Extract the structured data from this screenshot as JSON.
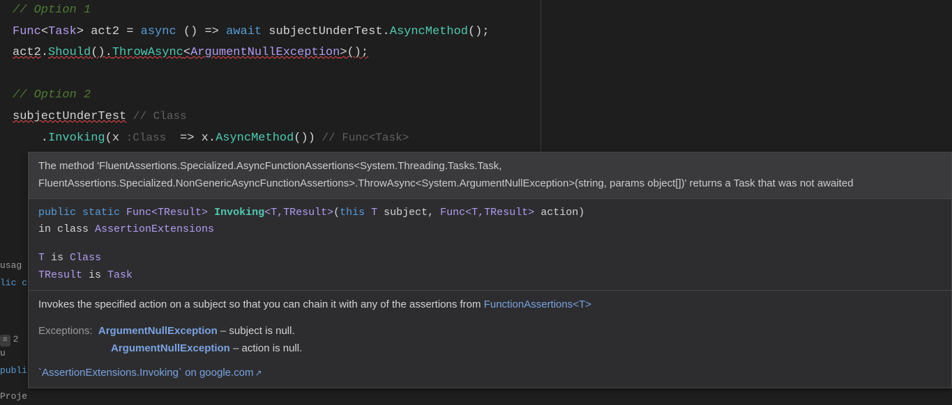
{
  "code": {
    "line0_comment": "// Option 1",
    "line1": {
      "t_func": "Func",
      "t_task": "Task",
      "v_act2": "act2",
      "eq": " = ",
      "k_async": "async",
      "arrow": " () => ",
      "k_await": "await",
      "v_sut": " subjectUnderTest",
      "dot": ".",
      "m_async": "AsyncMethod",
      "tail": "();"
    },
    "line2": {
      "v_act2": "act2",
      "dot1": ".",
      "m_should": "Should",
      "p1": "().",
      "m_throw": "ThrowAsync",
      "lt": "<",
      "t_ex": "ArgumentNullException",
      "gt": ">();"
    },
    "line4_comment": "// Option 2",
    "line5": {
      "v_sut": "subjectUnderTest",
      "hint": " // Class"
    },
    "line6": {
      "pad": "    .",
      "m_inv": "Invoking",
      "open": "(",
      "v_x": "x",
      "hint1": " :Class ",
      "arrow": " => ",
      "v_x2": "x",
      "dot": ".",
      "m_async": "AsyncMethod",
      "close": "())",
      "hint2": " // Func<Task>"
    }
  },
  "tooltip": {
    "warning": "The method 'FluentAssertions.Specialized.AsyncFunctionAssertions<System.Threading.Tasks.Task, FluentAssertions.Specialized.NonGenericAsyncFunctionAssertions>.ThrowAsync<System.ArgumentNullException>(string, params object[])' returns a Task that was not awaited",
    "sig": {
      "prefix": "public static ",
      "ret": "Func<TResult>",
      "name": " Invoking",
      "tparams": "<T,TResult>",
      "open": "(",
      "kw_this": "this ",
      "t_T": "T",
      "p1": " subject, ",
      "t_Func": "Func<T,TResult>",
      "p2": " action)",
      "inclass": "in class ",
      "cls": "AssertionExtensions"
    },
    "tparams_resolve": {
      "l1a": "T",
      "l1b": " is ",
      "l1c": "Class",
      "l2a": "TResult",
      "l2b": " is ",
      "l2c": "Task"
    },
    "desc_pre": "Invokes the specified action on a subject so that you can chain it with any of the assertions from ",
    "desc_link": "FunctionAssertions<T>",
    "exceptions_label": "Exceptions:",
    "ex1_name": "ArgumentNullException",
    "ex1_desc": " – subject is null.",
    "ex2_name": "ArgumentNullException",
    "ex2_desc": " – action is null.",
    "goog": "`AssertionExtensions.Invoking` on google.com"
  },
  "side": {
    "usag": "usag",
    "lic": "lic c",
    "two": "2 u",
    "publi": "publi",
    "proj": "Proje"
  }
}
